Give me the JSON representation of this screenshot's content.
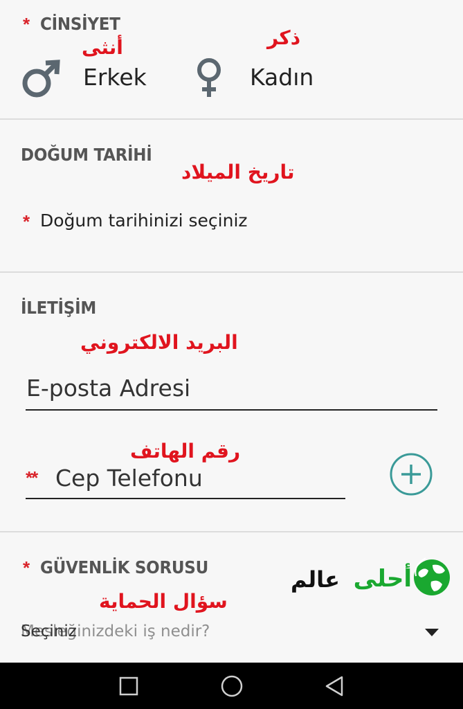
{
  "gender": {
    "required_mark": "*",
    "title": "CİNSİYET",
    "male_label": "Erkek",
    "female_label": "Kadın",
    "male_arabic": "أنثى",
    "female_arabic": "ذكر"
  },
  "birth": {
    "title": "DOĞUM TARİHİ",
    "arabic": "تاريخ الميلاد",
    "required_mark": "*",
    "picker_label": "Doğum tarihinizi seçiniz"
  },
  "contact": {
    "title": "İLETİŞİM",
    "email_arabic": "البريد الالكتروني",
    "email_placeholder": "E-posta Adresi",
    "phone_arabic": "رقم الهاتف",
    "phone_required_mark": "**",
    "phone_placeholder": "Cep Telefonu"
  },
  "security": {
    "required_mark": "*",
    "title": "GÜVENLİK SORUSU",
    "arabic": "سؤال الحماية",
    "select_value": "Seçiniz",
    "select_ghost": "Mesleğinizdeki iş nedir?"
  },
  "watermark": {
    "text_green": "أحلى",
    "text_black": "عالم"
  },
  "colors": {
    "accent_teal": "#3a9a98",
    "required_red": "#d9242b",
    "annotation_red": "#e0141e",
    "watermark_green": "#1aa830"
  }
}
